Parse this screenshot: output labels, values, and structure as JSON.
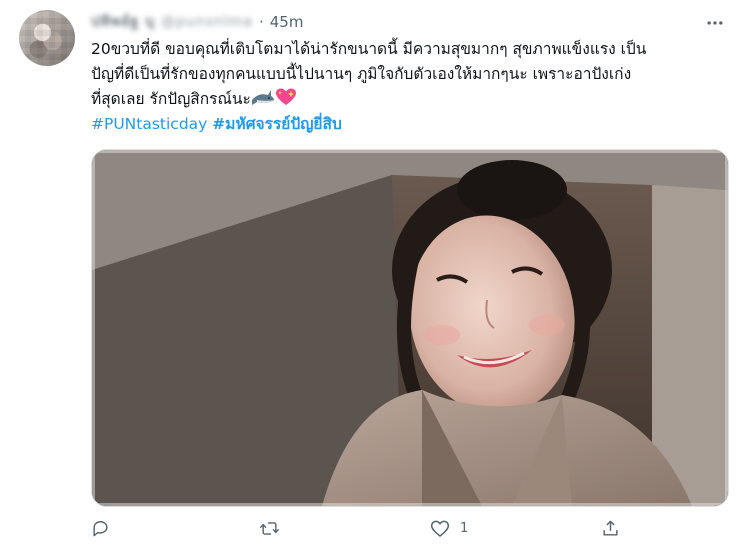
{
  "tweet": {
    "time": "45m",
    "separator": "·",
    "lines": [
      "20ขวบที่ดี ขอบคุณที่เติบโตมาได้น่ารักขนาดนี้ มีความสุขมากๆ สุขภาพแข็งแรง เป็น",
      "ปัญที่ดีเป็นที่รักของทุกคนแบบนี้ไปนานๆ ภูมิใจกับตัวเองให้มากๆนะ เพราะอาปังเก่ง",
      "ที่สุดเลย รักปัญสิกรณ์นะ"
    ],
    "hashtag_1": "#PUNtasticday",
    "hashtag_2": "#มหัศจรรย์ปัญยี่สิบ",
    "emojis": [
      "shark",
      "sparkling-heart"
    ]
  },
  "actions": {
    "reply_count": "",
    "retweet_count": "",
    "like_count": "1",
    "share_count": ""
  },
  "colors": {
    "link": "#1d9bf0",
    "text": "#0f1419",
    "muted": "#536471"
  }
}
